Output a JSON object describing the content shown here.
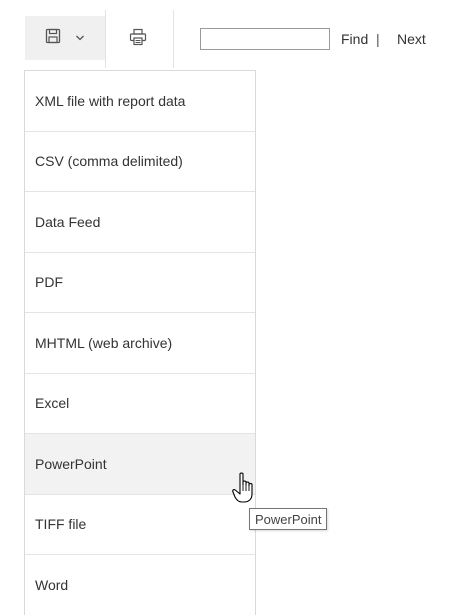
{
  "toolbar": {
    "save_icon": "floppy-disk-icon",
    "save_chevron": "chevron-down-icon",
    "print_icon": "printer-icon",
    "find_value": "",
    "find_label": "Find",
    "separator": "|",
    "next_label": "Next"
  },
  "menu": {
    "items": [
      {
        "label": "XML file with report data"
      },
      {
        "label": "CSV (comma delimited)"
      },
      {
        "label": "Data Feed"
      },
      {
        "label": "PDF"
      },
      {
        "label": "MHTML (web archive)"
      },
      {
        "label": "Excel"
      },
      {
        "label": "PowerPoint",
        "hovered": true
      },
      {
        "label": "TIFF file"
      },
      {
        "label": "Word"
      }
    ]
  },
  "tooltip": {
    "text": "PowerPoint"
  },
  "cursor": {
    "icon": "hand-pointer-icon"
  },
  "colors": {
    "hover_bg": "#f2f2f2",
    "border": "#d9d9d9",
    "text": "#333333"
  }
}
